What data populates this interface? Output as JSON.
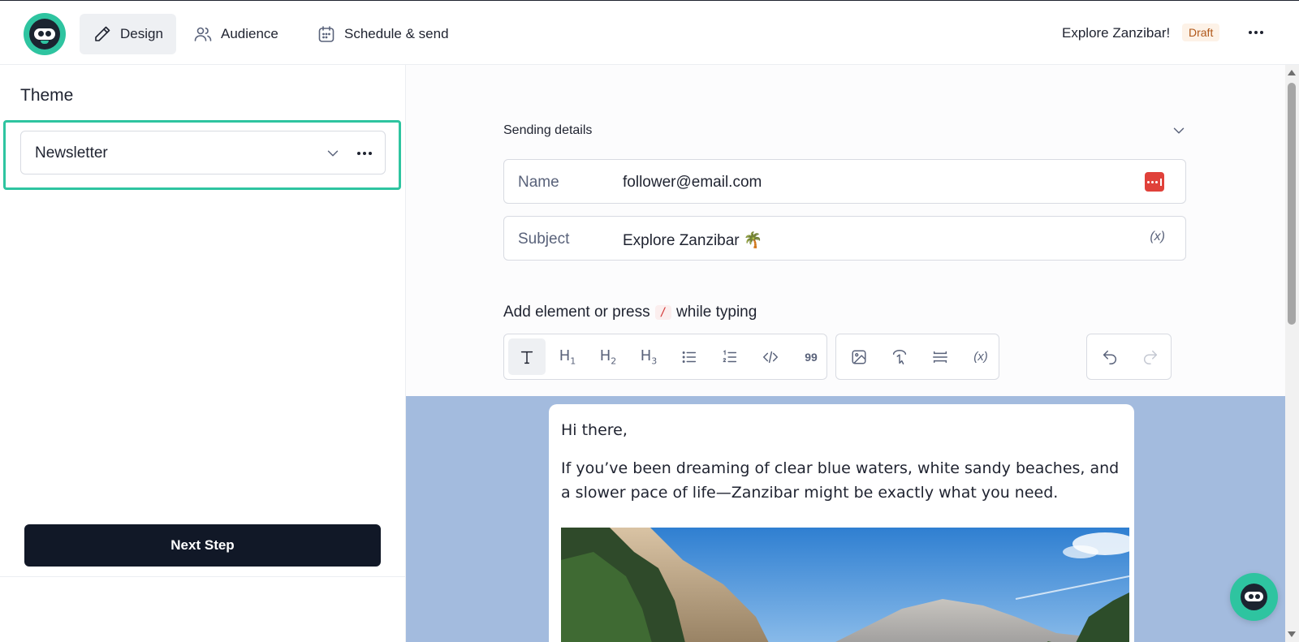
{
  "app": {
    "logo_icon": "sloth-logo-icon",
    "brand_color": "#2ec4a0"
  },
  "nav": {
    "tabs": [
      {
        "label": "Design",
        "icon": "pencil-icon",
        "active": true
      },
      {
        "label": "Audience",
        "icon": "users-icon",
        "active": false
      },
      {
        "label": "Schedule & send",
        "icon": "calendar-icon",
        "active": false
      }
    ]
  },
  "header": {
    "doc_title": "Explore Zanzibar!",
    "status_badge": "Draft",
    "more_icon": "more-horizontal-icon"
  },
  "left_panel": {
    "heading": "Theme",
    "theme_select": {
      "value": "Newsletter",
      "chevron_icon": "chevron-down-icon",
      "more_icon": "more-horizontal-icon"
    },
    "next_button": "Next Step"
  },
  "sending_details": {
    "label": "Sending details",
    "chevron_icon": "chevron-down-icon",
    "name_field": {
      "label": "Name",
      "value": "follower@email.com",
      "icon": "password-manager-icon"
    },
    "subject_field": {
      "label": "Subject",
      "value": "Explore Zanzibar 🌴",
      "icon": "variable-icon",
      "icon_text": "(x)"
    }
  },
  "editor": {
    "hint_prefix": "Add element or press",
    "hint_key": "/",
    "hint_suffix": "while typing",
    "toolbar": {
      "h1": "H",
      "h1_sub": "1",
      "h2": "H",
      "h2_sub": "2",
      "h3": "H",
      "h3_sub": "3",
      "quote": "99",
      "variable": "(x)"
    }
  },
  "email": {
    "greeting": "Hi there,",
    "body": "If you’ve been dreaming of clear blue waters, white sandy beaches, and a slower pace of life—Zanzibar might be exactly what you need.",
    "image_icon": "mountain-landscape-image"
  },
  "chat": {
    "icon": "sloth-chat-icon"
  }
}
